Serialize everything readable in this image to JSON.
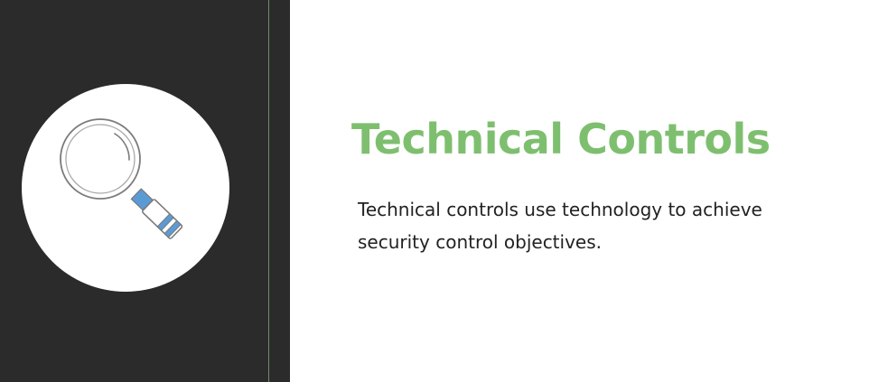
{
  "slide": {
    "title": "Technical Controls",
    "body": "Technical controls use technology to achieve security control objectives.",
    "icon": "magnifying-glass-icon",
    "colors": {
      "title": "#7ebf6f",
      "body_text": "#222222",
      "left_panel": "#2b2b2b",
      "accent": "#5b9bd5",
      "background": "#ffffff"
    }
  }
}
